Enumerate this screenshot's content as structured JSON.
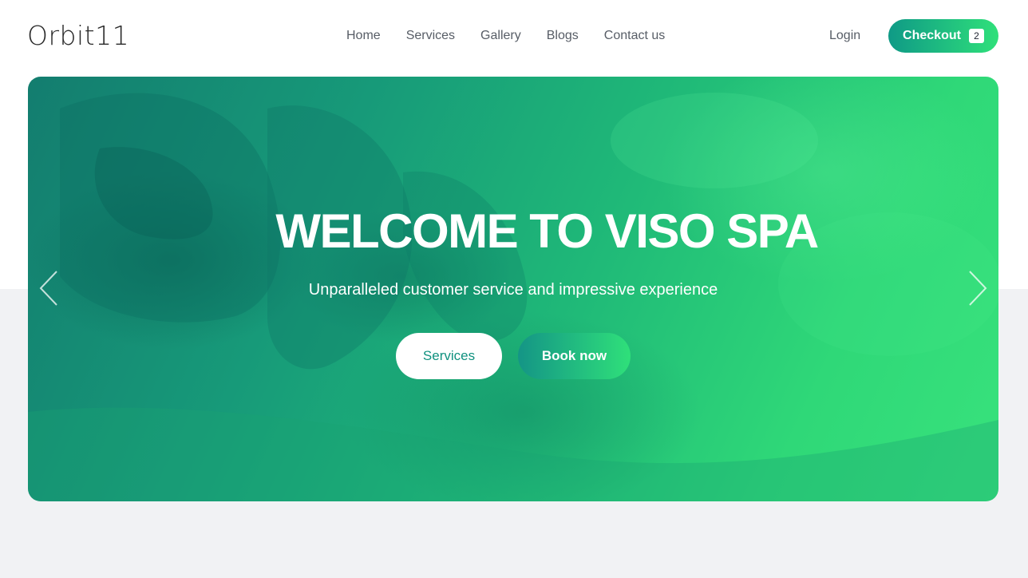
{
  "brand": {
    "logo_text": "Orbit11"
  },
  "nav": {
    "items": [
      {
        "label": "Home"
      },
      {
        "label": "Services"
      },
      {
        "label": "Gallery"
      },
      {
        "label": "Blogs"
      },
      {
        "label": "Contact us"
      }
    ]
  },
  "header_actions": {
    "login_label": "Login",
    "checkout_label": "Checkout",
    "cart_count": "2"
  },
  "hero": {
    "title": "WELCOME TO VISO SPA",
    "subtitle": "Unparalleled customer service and impressive experience",
    "primary_button": "Services",
    "secondary_button": "Book now",
    "prev_icon": "chevron-left-icon",
    "next_icon": "chevron-right-icon"
  },
  "colors": {
    "accent_start": "#0f9a86",
    "accent_end": "#2fe07a",
    "nav_text": "#575d66",
    "page_background": "#f1f2f4"
  }
}
